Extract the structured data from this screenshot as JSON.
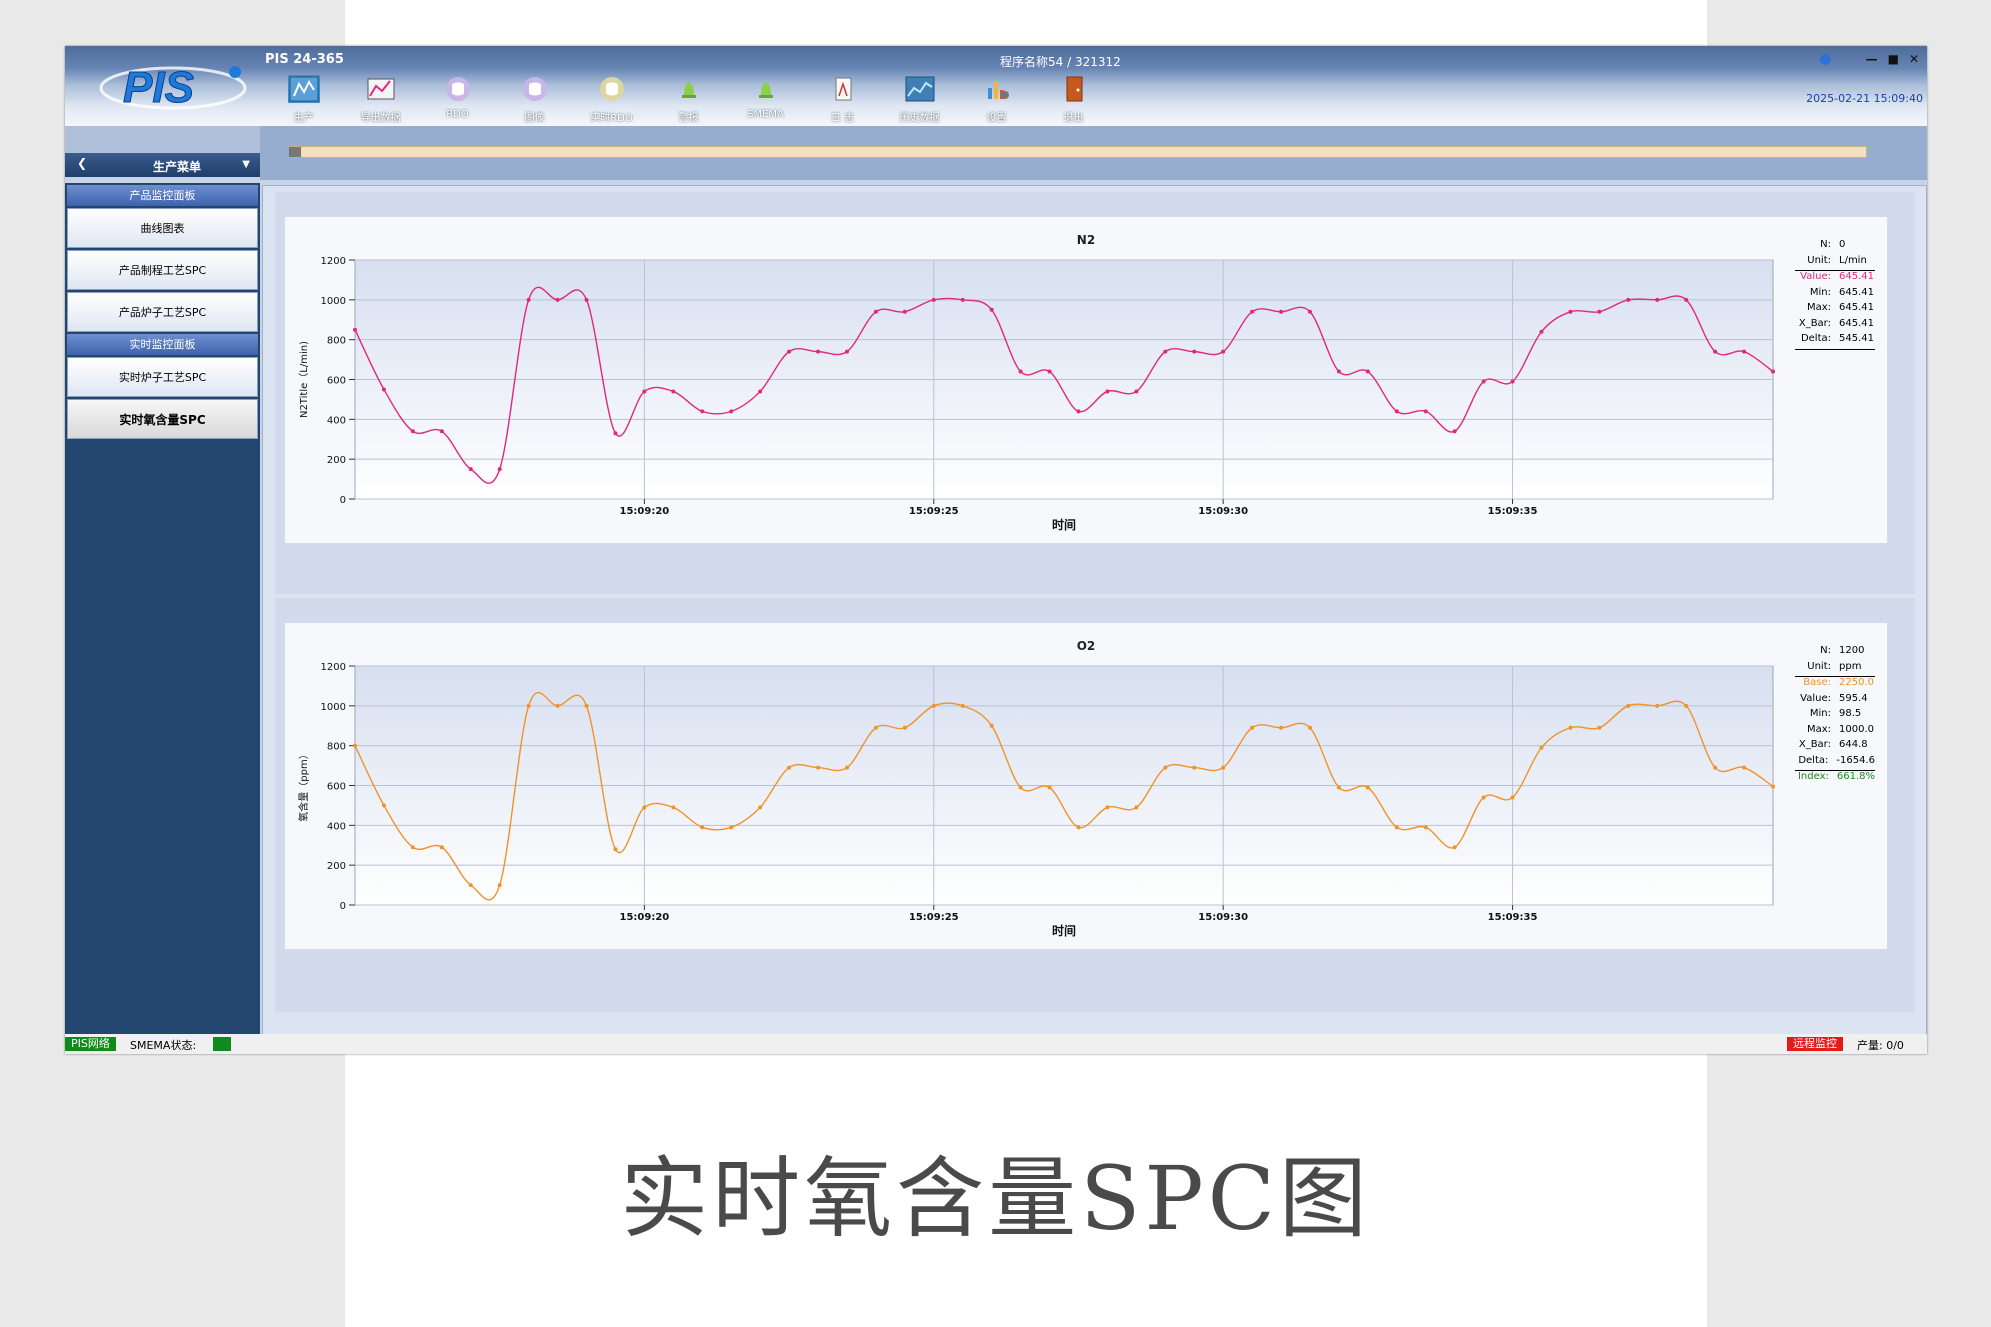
{
  "app": {
    "name": "PIS 24-365",
    "program": "程序名称54 / 321312",
    "datetime": "2025-02-21 15:09:40",
    "logo_text": "PIS"
  },
  "toolbar": [
    {
      "label": "生产",
      "icon": "production-icon"
    },
    {
      "label": "导出数据",
      "icon": "export-chart-icon"
    },
    {
      "label": "RDO",
      "icon": "database-icon"
    },
    {
      "label": "图像",
      "icon": "image-database-icon"
    },
    {
      "label": "实时RDO",
      "icon": "realtime-database-icon"
    },
    {
      "label": "警报",
      "icon": "alarm-bell-icon"
    },
    {
      "label": "SMEMA",
      "icon": "smema-bell-icon"
    },
    {
      "label": "日 志",
      "icon": "log-document-icon"
    },
    {
      "label": "历史数据",
      "icon": "history-chart-icon"
    },
    {
      "label": "设置",
      "icon": "settings-icon"
    },
    {
      "label": "退出",
      "icon": "exit-door-icon"
    }
  ],
  "menu": {
    "title": "生产菜单"
  },
  "sidebar": {
    "group1": "产品监控面板",
    "group1_items": [
      "曲线图表",
      "产品制程工艺SPC",
      "产品炉子工艺SPC"
    ],
    "group2": "实时监控面板",
    "group2_items": [
      "实时炉子工艺SPC",
      "实时氧含量SPC"
    ]
  },
  "progress": {
    "value": 0
  },
  "charts": {
    "n2": {
      "title": "N2",
      "ylabel": "N2Title（L/min)",
      "xlabel": "时间",
      "stats": [
        {
          "k": "N:",
          "v": "0"
        },
        {
          "k": "Unit:",
          "v": "L/min"
        },
        {
          "k": "Value:",
          "v": "645.41"
        },
        {
          "k": "Min:",
          "v": "645.41"
        },
        {
          "k": "Max:",
          "v": "645.41"
        },
        {
          "k": "X_Bar:",
          "v": "645.41"
        },
        {
          "k": "Delta:",
          "v": "545.41"
        }
      ]
    },
    "o2": {
      "title": "O2",
      "ylabel": "氧含量（ppm）",
      "xlabel": "时间",
      "stats": [
        {
          "k": "N:",
          "v": "1200"
        },
        {
          "k": "Unit:",
          "v": "ppm"
        },
        {
          "k": "Base:",
          "v": "2250.0"
        },
        {
          "k": "Value:",
          "v": "595.4"
        },
        {
          "k": "Min:",
          "v": "98.5"
        },
        {
          "k": "Max:",
          "v": "1000.0"
        },
        {
          "k": "X_Bar:",
          "v": "644.8"
        },
        {
          "k": "Delta:",
          "v": "-1654.6"
        },
        {
          "k": "Index:",
          "v": "661.8%"
        }
      ]
    }
  },
  "status": {
    "network": "PIS网络",
    "smema_label": "SMEMA状态:",
    "remote": "远程监控",
    "output": "产量: 0/0"
  },
  "caption": "实时氧含量SPC图",
  "colors": {
    "n2_line": "#e0287e",
    "o2_line": "#f0932a",
    "accent": "#22466f"
  },
  "chart_data": [
    {
      "type": "line",
      "title": "N2",
      "xlabel": "时间",
      "ylabel": "N2Title（L/min)",
      "ylim": [
        0,
        1200
      ],
      "yticks": [
        0,
        200,
        400,
        600,
        800,
        1000,
        1200
      ],
      "xticks": [
        "15:09:20",
        "15:09:25",
        "15:09:30",
        "15:09:35"
      ],
      "x_start": "15:09:15",
      "x_step_seconds": 0.5,
      "grid": true,
      "series": [
        {
          "values": [
            850,
            550,
            340,
            340,
            150,
            150,
            1000,
            1000,
            1000,
            330,
            540,
            540,
            440,
            440,
            540,
            740,
            740,
            740,
            940,
            940,
            1000,
            1000,
            950,
            640,
            640,
            440,
            540,
            540,
            740,
            740,
            740,
            940,
            940,
            940,
            640,
            640,
            440,
            440,
            340,
            590,
            590,
            840,
            940,
            940,
            1000,
            1000,
            1000,
            740,
            740,
            640
          ]
        }
      ]
    },
    {
      "type": "line",
      "title": "O2",
      "xlabel": "时间",
      "ylabel": "氧含量（ppm）",
      "ylim": [
        0,
        1200
      ],
      "yticks": [
        0,
        200,
        400,
        600,
        800,
        1000,
        1200
      ],
      "xticks": [
        "15:09:20",
        "15:09:25",
        "15:09:30",
        "15:09:35"
      ],
      "x_start": "15:09:15",
      "x_step_seconds": 0.5,
      "grid": true,
      "series": [
        {
          "values": [
            800,
            500,
            290,
            290,
            100,
            100,
            1000,
            1000,
            1000,
            280,
            490,
            490,
            390,
            390,
            490,
            690,
            690,
            690,
            890,
            890,
            1000,
            1000,
            900,
            590,
            590,
            390,
            490,
            490,
            690,
            690,
            690,
            890,
            890,
            890,
            590,
            590,
            390,
            390,
            290,
            540,
            540,
            790,
            890,
            890,
            1000,
            1000,
            1000,
            690,
            690,
            595
          ]
        }
      ]
    }
  ]
}
